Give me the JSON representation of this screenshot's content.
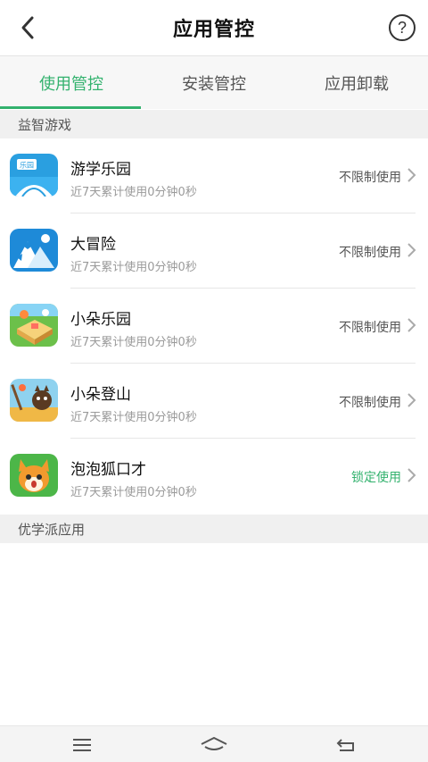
{
  "header": {
    "title": "应用管控",
    "help_symbol": "?"
  },
  "tabs": [
    {
      "label": "使用管控",
      "active": true
    },
    {
      "label": "安装管控",
      "active": false
    },
    {
      "label": "应用卸载",
      "active": false
    }
  ],
  "sections": {
    "games": "益智游戏",
    "youxuepai": "优学派应用"
  },
  "apps": [
    {
      "name": "游学乐园",
      "usage": "近7天累计使用0分钟0秒",
      "status": "不限制使用",
      "icon_badge": "乐园",
      "icon": "park-app-icon"
    },
    {
      "name": "大冒险",
      "usage": "近7天累计使用0分钟0秒",
      "status": "不限制使用",
      "icon": "adventure-app-icon"
    },
    {
      "name": "小朵乐园",
      "usage": "近7天累计使用0分钟0秒",
      "status": "不限制使用",
      "icon": "xiaoduo-park-app-icon"
    },
    {
      "name": "小朵登山",
      "usage": "近7天累计使用0分钟0秒",
      "status": "不限制使用",
      "icon": "xiaoduo-climb-app-icon"
    },
    {
      "name": "泡泡狐口才",
      "usage": "近7天累计使用0分钟0秒",
      "status": "锁定使用",
      "icon": "fox-app-icon"
    }
  ],
  "colors": {
    "accent": "#33b26e",
    "section_bg": "#f0f0f0",
    "tab_bg": "#f7f7f7"
  }
}
